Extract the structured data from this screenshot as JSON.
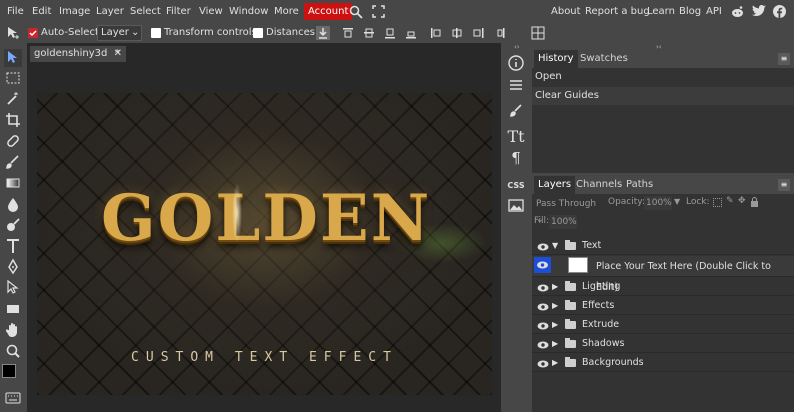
{
  "menu": {
    "items": [
      "File",
      "Edit",
      "Image",
      "Layer",
      "Select",
      "Filter",
      "View",
      "Window",
      "More"
    ],
    "account": "Account",
    "right_links": [
      "About",
      "Report a bug",
      "Learn",
      "Blog",
      "API"
    ]
  },
  "options": {
    "auto_select": "Auto-Select",
    "layer_value": "Layer",
    "transform_controls": "Transform controls",
    "distances": "Distances"
  },
  "document": {
    "tab_name": "goldenshiny3d",
    "tab_modified": "*",
    "tab_close": "✕",
    "canvas_title": "GOLDEN",
    "canvas_subtitle": "CUSTOM TEXT EFFECT"
  },
  "history_panel": {
    "tabs": [
      "History",
      "Swatches"
    ],
    "rows": [
      "Open",
      "Clear Guides"
    ]
  },
  "layers_panel": {
    "tabs": [
      "Layers",
      "Channels",
      "Paths"
    ],
    "blend_mode": "Pass Through",
    "opacity_label": "Opacity:",
    "opacity_value": "100%",
    "lock_label": "Lock:",
    "fill_label": "Fill:",
    "fill_value": "100%",
    "layers": [
      {
        "name": "Text",
        "type": "folder",
        "expanded": true
      },
      {
        "name": "Place Your Text Here (Double Click to Edit)",
        "type": "smart-object",
        "selected": true
      },
      {
        "name": "Lighting",
        "type": "folder"
      },
      {
        "name": "Effects",
        "type": "folder"
      },
      {
        "name": "Extrude",
        "type": "folder"
      },
      {
        "name": "Shadows",
        "type": "folder"
      },
      {
        "name": "Backgrounds",
        "type": "folder"
      }
    ]
  },
  "icons": {
    "menu_search": "search-icon",
    "menu_fullscreen": "fullscreen-icon",
    "social": [
      "reddit-icon",
      "twitter-icon",
      "facebook-icon"
    ]
  },
  "colors": {
    "account_red": "#cc1111",
    "selection_blue": "#1c4fd6",
    "ui_bg": "#474747",
    "panel_bg": "#333333"
  }
}
